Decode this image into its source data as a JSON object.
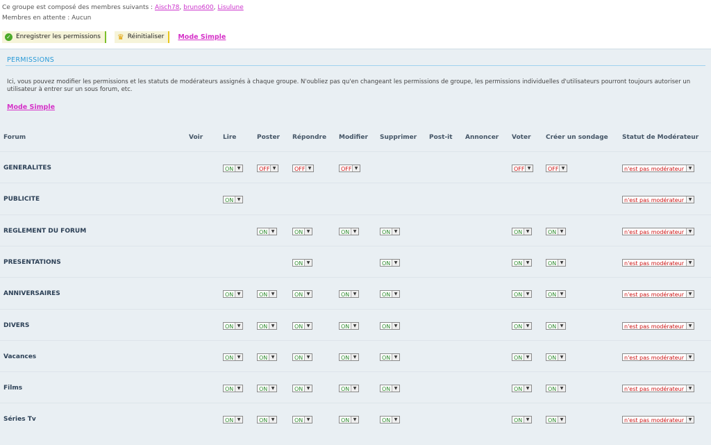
{
  "header": {
    "members_prefix": "Ce groupe est composé des membres suivants : ",
    "members": [
      "Aisch78",
      "bruno600",
      "Lisulune"
    ],
    "pending_label": "Membres en attente : Aucun"
  },
  "toolbar": {
    "save_label": "Enregistrer les permissions",
    "reset_label": "Réinitialiser",
    "simple_mode_label": "Mode Simple"
  },
  "panel": {
    "title": "PERMISSIONS",
    "description": "Ici, vous pouvez modifier les permissions et les statuts de modérateurs assignés à chaque groupe. N'oubliez pas qu'en changeant les permissions de groupe, les permissions individuelles d'utilisateurs pourront toujours autoriser un utilisateur à entrer sur un sous forum, etc.",
    "simple_mode_label": "Mode Simple"
  },
  "table": {
    "columns": [
      "Forum",
      "Voir",
      "Lire",
      "Poster",
      "Répondre",
      "Modifier",
      "Supprimer",
      "Post-it",
      "Annoncer",
      "Voter",
      "Créer un sondage",
      "Statut de Modérateur"
    ],
    "moderator_value": "n'est pas modérateur",
    "rows": [
      {
        "name": "GENERALITES",
        "cells": {
          "Lire": "ON",
          "Poster": "OFF",
          "Répondre": "OFF",
          "Modifier": "OFF",
          "Voter": "OFF",
          "Créer un sondage": "OFF"
        }
      },
      {
        "name": "PUBLICITE",
        "cells": {
          "Lire": "ON"
        }
      },
      {
        "name": "REGLEMENT DU FORUM",
        "cells": {
          "Poster": "ON",
          "Répondre": "ON",
          "Modifier": "ON",
          "Supprimer": "ON",
          "Voter": "ON",
          "Créer un sondage": "ON"
        }
      },
      {
        "name": "PRESENTATIONS",
        "cells": {
          "Répondre": "ON",
          "Supprimer": "ON",
          "Voter": "ON",
          "Créer un sondage": "ON"
        }
      },
      {
        "name": "ANNIVERSAIRES",
        "cells": {
          "Lire": "ON",
          "Poster": "ON",
          "Répondre": "ON",
          "Modifier": "ON",
          "Supprimer": "ON",
          "Voter": "ON",
          "Créer un sondage": "ON"
        }
      },
      {
        "name": "DIVERS",
        "cells": {
          "Lire": "ON",
          "Poster": "ON",
          "Répondre": "ON",
          "Modifier": "ON",
          "Supprimer": "ON",
          "Voter": "ON",
          "Créer un sondage": "ON"
        }
      },
      {
        "name": "Vacances",
        "cells": {
          "Lire": "ON",
          "Poster": "ON",
          "Répondre": "ON",
          "Modifier": "ON",
          "Supprimer": "ON",
          "Voter": "ON",
          "Créer un sondage": "ON"
        }
      },
      {
        "name": "Films",
        "cells": {
          "Lire": "ON",
          "Poster": "ON",
          "Répondre": "ON",
          "Modifier": "ON",
          "Supprimer": "ON",
          "Voter": "ON",
          "Créer un sondage": "ON"
        }
      },
      {
        "name": "Séries Tv",
        "cells": {
          "Lire": "ON",
          "Poster": "ON",
          "Répondre": "ON",
          "Modifier": "ON",
          "Supprimer": "ON",
          "Voter": "ON",
          "Créer un sondage": "ON"
        }
      }
    ]
  },
  "colors": {
    "on": "#2e8b2e",
    "off": "#cc1111",
    "link": "#d531c8",
    "title": "#2a9bd8"
  }
}
